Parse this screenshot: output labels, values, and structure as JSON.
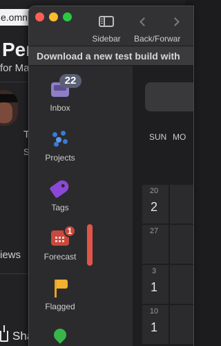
{
  "background_page": {
    "url_fragment": "e.omn",
    "title_fragment": "Per",
    "subtitle_fragment": "for Ma",
    "snippet1": "T",
    "snippet2": "S",
    "views_fragment": "iews",
    "share_label": "Sha"
  },
  "toolbar": {
    "sidebar_label": "Sidebar",
    "nav_label": "Back/Forwar"
  },
  "banner": {
    "text": "Download a new test build with"
  },
  "sidebar": {
    "items": [
      {
        "label": "Inbox",
        "badge": "22",
        "icon": "inbox-tray-icon",
        "color": "#8e7ec7"
      },
      {
        "label": "Projects",
        "icon": "projects-dots-icon",
        "color": "#3a7bd5"
      },
      {
        "label": "Tags",
        "icon": "tag-icon",
        "color": "#8b48d8"
      },
      {
        "label": "Forecast",
        "badge": "1",
        "icon": "calendar-icon",
        "color": "#c8493d"
      },
      {
        "label": "Flagged",
        "icon": "flag-icon",
        "color": "#f2b22e"
      },
      {
        "label": "",
        "icon": "location-pin-icon",
        "color": "#3ab54a"
      }
    ]
  },
  "calendar": {
    "day_headers": [
      "SUN",
      "MO"
    ],
    "cells": [
      {
        "day": "20",
        "num": "2"
      },
      {
        "day": "27",
        "num": ""
      },
      {
        "day": "3",
        "num": "1"
      },
      {
        "day": "10",
        "num": "1"
      }
    ]
  }
}
